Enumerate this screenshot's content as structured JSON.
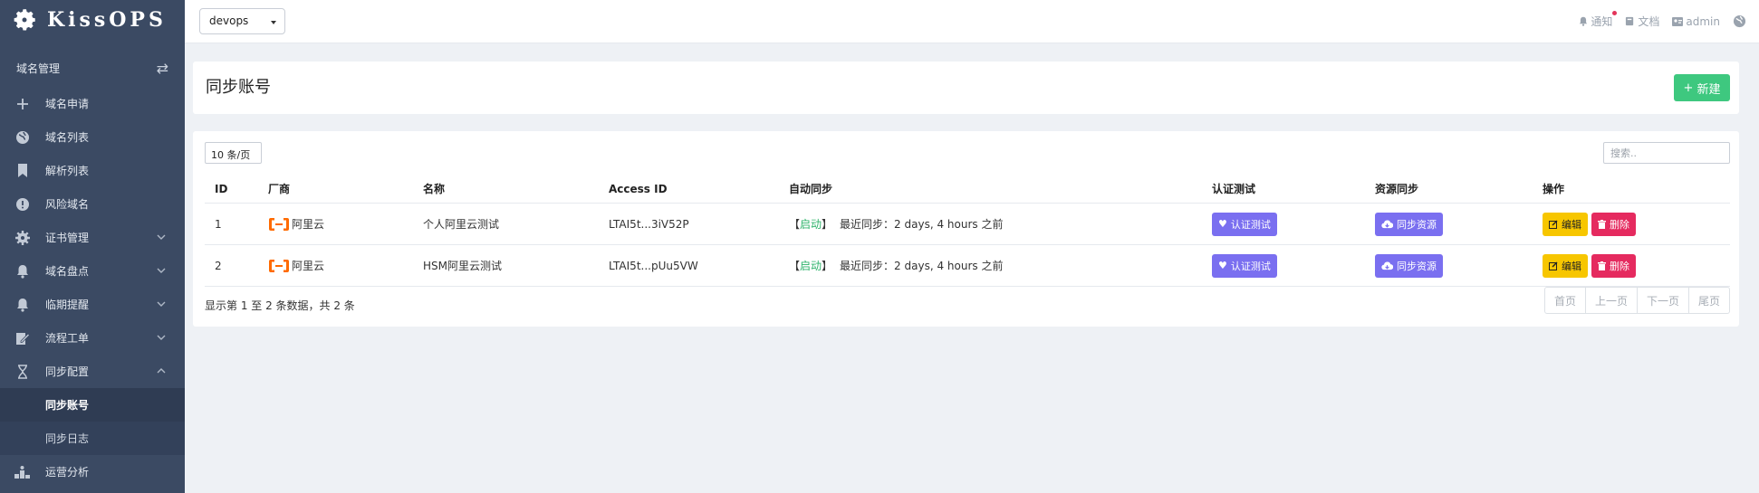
{
  "app": {
    "brand": "KissOPS"
  },
  "sidebar": {
    "section_title": "域名管理",
    "items": [
      {
        "label": "域名申请",
        "icon": "plus-icon"
      },
      {
        "label": "域名列表",
        "icon": "globe-icon"
      },
      {
        "label": "解析列表",
        "icon": "bookmark-icon"
      },
      {
        "label": "风险域名",
        "icon": "alert-circle-icon"
      },
      {
        "label": "证书管理",
        "icon": "gear-icon"
      },
      {
        "label": "域名盘点",
        "icon": "bell-icon"
      },
      {
        "label": "临期提醒",
        "icon": "bell-icon"
      },
      {
        "label": "流程工单",
        "icon": "edit-doc-icon"
      },
      {
        "label": "同步配置",
        "icon": "hourglass-icon"
      },
      {
        "label": "运营分析",
        "icon": "bar-chart-icon"
      }
    ],
    "sub_items": [
      {
        "label": "同步账号"
      },
      {
        "label": "同步日志"
      }
    ]
  },
  "topbar": {
    "env_value": "devops",
    "notify_label": "通知",
    "docs_label": "文档",
    "user_label": "admin"
  },
  "page": {
    "title": "同步账号",
    "new_button": "新建"
  },
  "table": {
    "per_page": "10 条/页",
    "search_placeholder": "搜索..",
    "columns": [
      "ID",
      "厂商",
      "名称",
      "Access ID",
      "自动同步",
      "认证测试",
      "资源同步",
      "操作"
    ],
    "rows": [
      {
        "id": "1",
        "vendor": "阿里云",
        "name": "个人阿里云测试",
        "access_id": "LTAI5t...3iV52P",
        "auto_bracket_open": "【",
        "auto_status": "启动",
        "auto_bracket_close": "】",
        "last_sync": "最近同步：2 days, 4 hours 之前",
        "auth_btn": "认证测试",
        "sync_btn": "同步资源",
        "edit_btn": "编辑",
        "delete_btn": "删除"
      },
      {
        "id": "2",
        "vendor": "阿里云",
        "name": "HSM阿里云测试",
        "access_id": "LTAI5t...pUu5VW",
        "auto_bracket_open": "【",
        "auto_status": "启动",
        "auto_bracket_close": "】",
        "last_sync": "最近同步：2 days, 4 hours 之前",
        "auth_btn": "认证测试",
        "sync_btn": "同步资源",
        "edit_btn": "编辑",
        "delete_btn": "删除"
      }
    ],
    "summary": "显示第 1 至 2 条数据，共 2 条",
    "pager": [
      "首页",
      "上一页",
      "下一页",
      "尾页"
    ]
  },
  "colors": {
    "sidebar_bg": "#3b4a63",
    "accent_green": "#3ec87f",
    "auth_purple": "#7a6ff0",
    "edit_yellow": "#f7c600",
    "delete_red": "#e52a5f",
    "vendor_orange": "#ff6a00"
  }
}
